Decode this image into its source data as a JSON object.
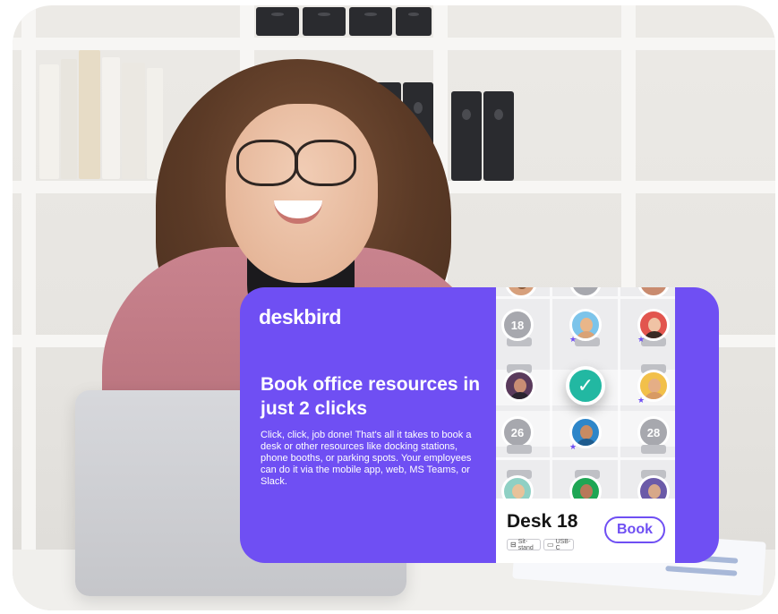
{
  "brand": {
    "logo_text": "deskbird"
  },
  "promo": {
    "headline": "Book office resources in just 2 clicks",
    "description": "Click, click, job done! That's all it takes to book a desk or other resources like docking stations, phone booths, or parking spots. Your employees can do it via the mobile app, web, MS Teams, or Slack."
  },
  "floor_map": {
    "desk_numbers": [
      "18",
      "26",
      "28"
    ],
    "selected_icon": "check-icon"
  },
  "booking": {
    "desk_title": "Desk 18",
    "features": [
      {
        "icon": "sit-stand-icon",
        "label": "Sit-stand"
      },
      {
        "icon": "monitor-icon",
        "label": "USB-C"
      }
    ],
    "book_label": "Book"
  },
  "colors": {
    "brand_purple": "#6f4ff3",
    "check_green": "#22b8a2"
  }
}
